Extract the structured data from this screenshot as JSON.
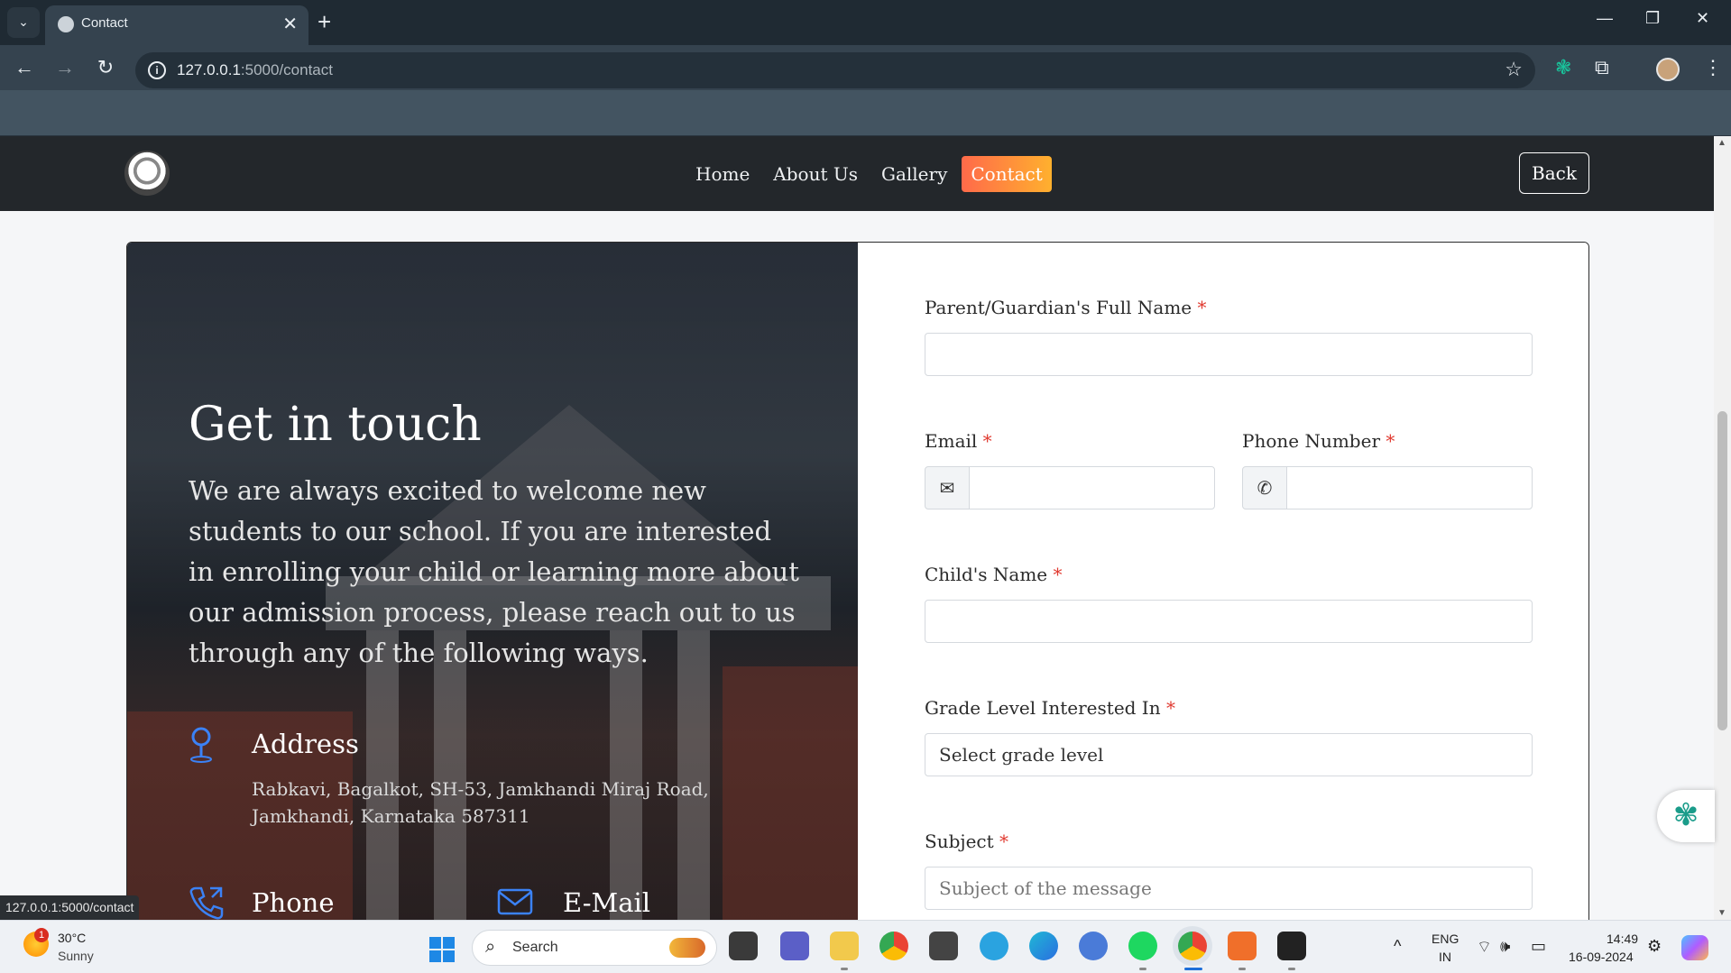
{
  "browser": {
    "tab_title": "Contact",
    "tab_close": "✕",
    "new_tab": "+",
    "tab_search": "⌄",
    "url_host": "127.0.0.1",
    "url_path": ":5000/contact",
    "win_min": "—",
    "win_restore": "❐",
    "win_close": "✕",
    "back": "←",
    "forward": "→",
    "reload": "↻",
    "star": "☆",
    "ext_puzzle": "⧉",
    "menu": "⋮",
    "extension_icon": "❃",
    "info": "i"
  },
  "nav": {
    "links": [
      "Home",
      "About Us",
      "Gallery",
      "Contact"
    ],
    "active": "Contact",
    "back_label": "Back"
  },
  "hero": {
    "title": "Get in touch",
    "description": "We are always excited to welcome new students to our school. If you are interested in enrolling your child or learning more about our admission process, please reach out to us through any of the following ways.",
    "address_label": "Address",
    "address_text": "Rabkavi, Bagalkot, SH-53, Jamkhandi Miraj Road, Jamkhandi, Karnataka 587311",
    "phone_label": "Phone",
    "email_label": "E-Mail",
    "address_icon": "location-pin-icon",
    "phone_icon": "phone-icon",
    "email_icon": "mail-icon"
  },
  "form": {
    "parent_label": "Parent/Guardian's Full Name",
    "email_label": "Email",
    "phone_label": "Phone Number",
    "child_label": "Child's Name",
    "grade_label": "Grade Level Interested In",
    "grade_value": "Select grade level",
    "subject_label": "Subject",
    "subject_placeholder": "Subject of the message",
    "required_mark": "*",
    "email_addon": "✉",
    "phone_addon": "✆"
  },
  "status_bar_url": "127.0.0.1:5000/contact",
  "taskbar": {
    "weather_temp": "30°C",
    "weather_cond": "Sunny",
    "weather_badge": "1",
    "search_label": "Search",
    "lang_line1": "ENG",
    "lang_line2": "IN",
    "time": "14:49",
    "date": "16-09-2024",
    "tray_up": "^",
    "wifi": "⌔",
    "volume": "🕪",
    "battery": "▭"
  },
  "colors": {
    "nav_bg": "#23272b",
    "active_gradient_start": "#ff6a4a",
    "active_gradient_end": "#ffb02e",
    "required": "#e0392f",
    "icon_blue": "#3b82f6"
  }
}
